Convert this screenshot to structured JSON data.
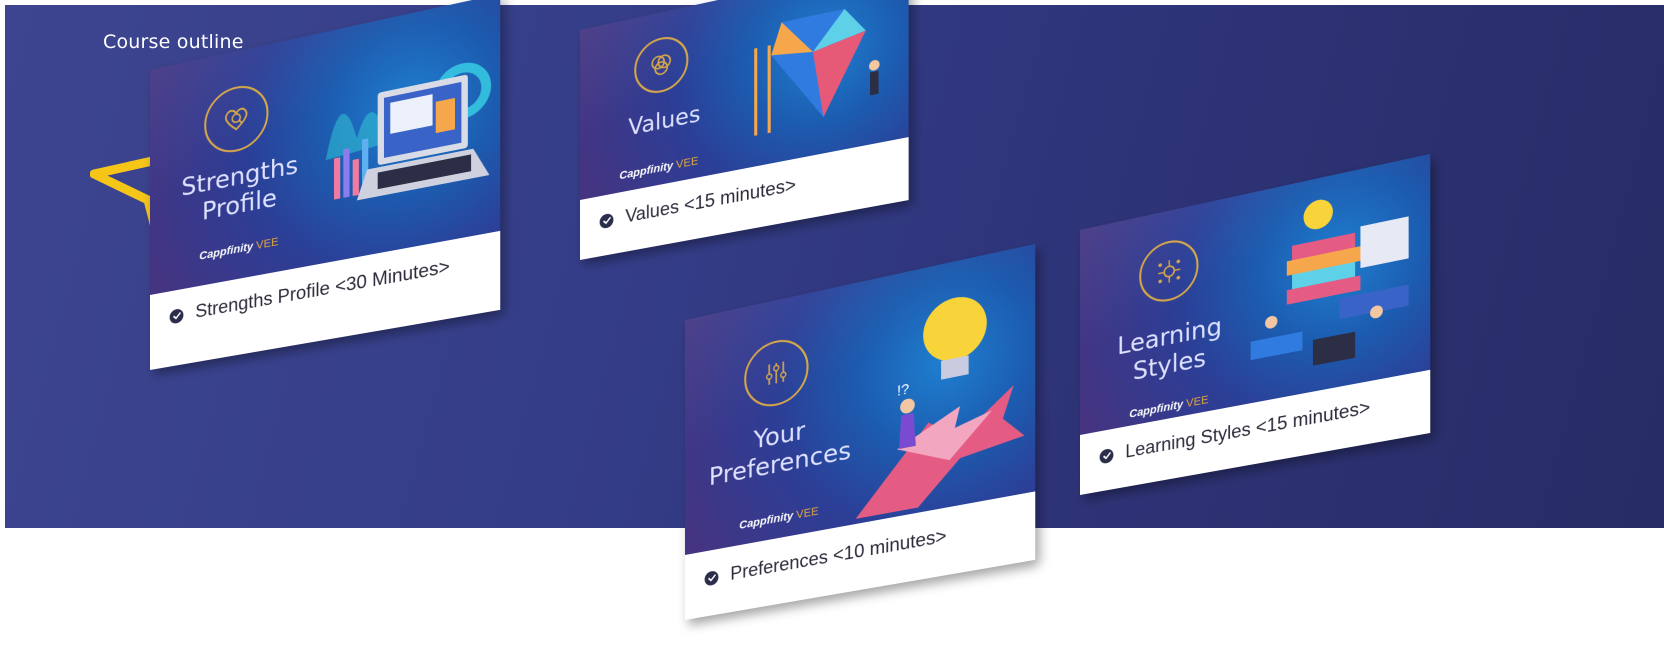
{
  "banner": {
    "title": "Course outline",
    "colors": {
      "background": "#343d88",
      "accent": "#f5c518"
    }
  },
  "cursor": {
    "icon": "pointer-arrow-icon",
    "color": "#f5c518"
  },
  "logo": {
    "brand": "Cappfinity",
    "suffix": "VEE"
  },
  "cards": [
    {
      "id": "strengths",
      "title_line1": "Strengths",
      "title_line2": "Profile",
      "icon": "heart-search-icon",
      "caption": "Strengths Profile <30 Minutes>",
      "status": "completed"
    },
    {
      "id": "values",
      "title_line1": "Values",
      "icon": "overlapping-circles-icon",
      "caption": "Values <15 minutes>",
      "status": "completed"
    },
    {
      "id": "preferences",
      "title_line1": "Your",
      "title_line2": "Preferences",
      "icon": "sliders-icon",
      "caption": "Preferences <10 minutes>",
      "status": "completed"
    },
    {
      "id": "learning",
      "title_line1": "Learning",
      "title_line2": "Styles",
      "icon": "brain-network-icon",
      "caption": "Learning Styles <15 minutes>",
      "status": "completed"
    }
  ]
}
